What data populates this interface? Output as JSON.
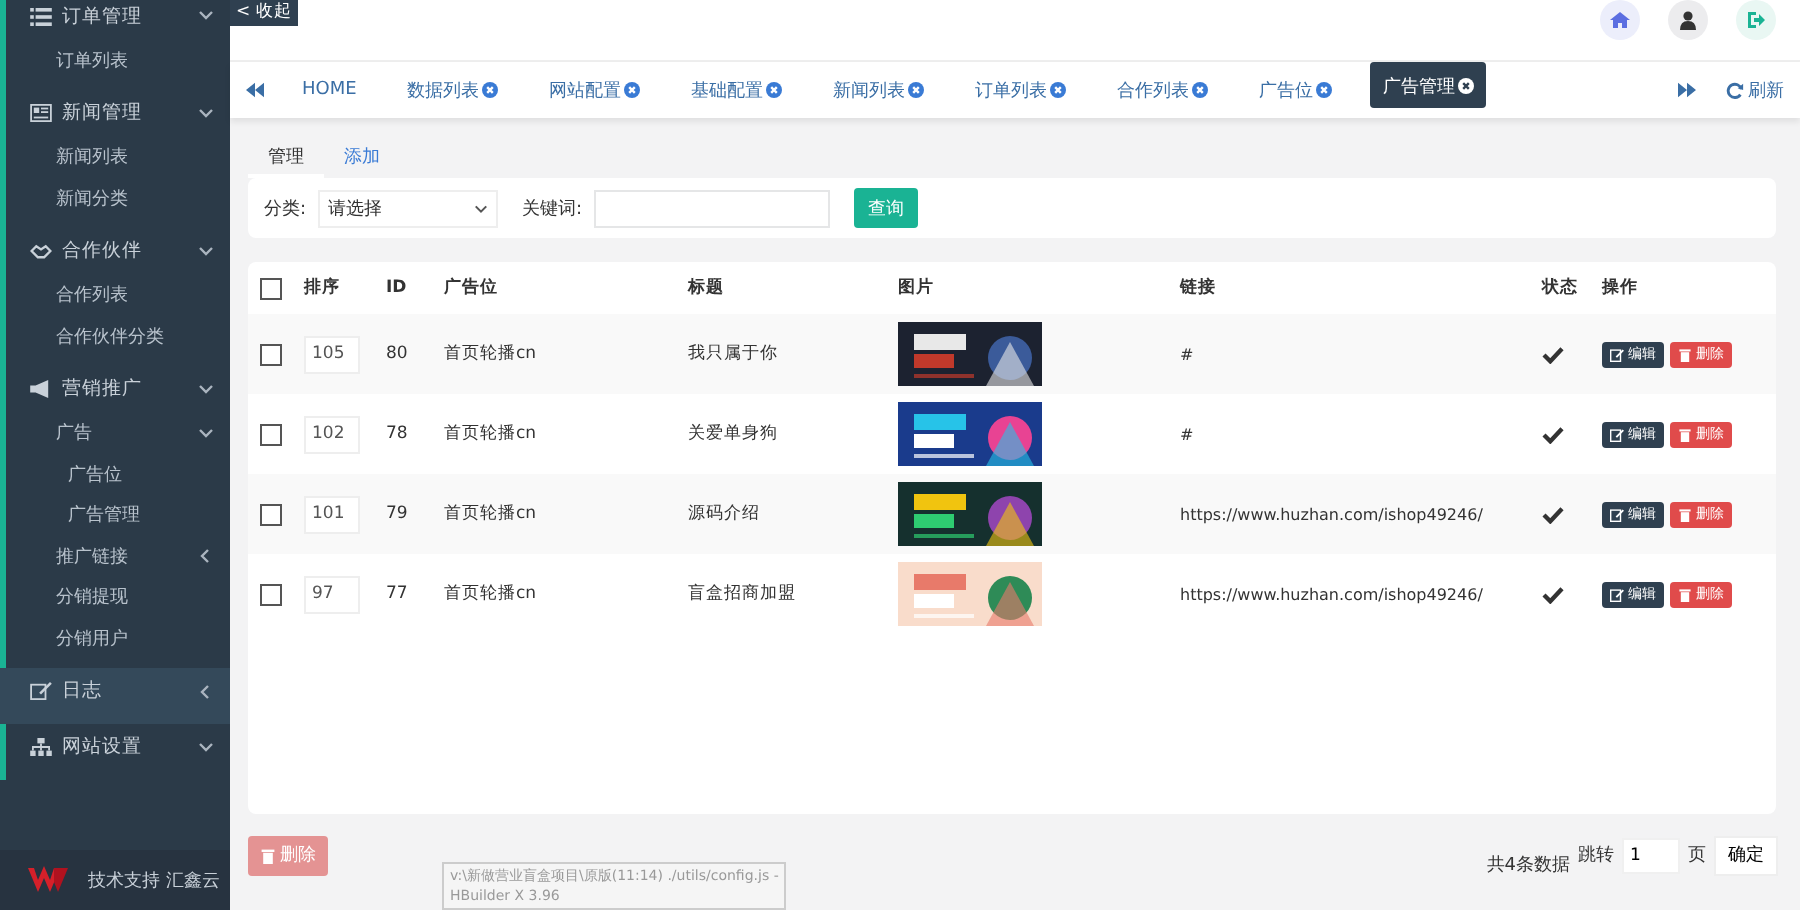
{
  "sidebar": {
    "groups": [
      {
        "label": "订单管理",
        "expanded": true,
        "children": [
          {
            "label": "订单列表"
          }
        ]
      },
      {
        "label": "新闻管理",
        "expanded": true,
        "children": [
          {
            "label": "新闻列表"
          },
          {
            "label": "新闻分类"
          }
        ]
      },
      {
        "label": "合作伙伴",
        "expanded": true,
        "children": [
          {
            "label": "合作列表"
          },
          {
            "label": "合作伙伴分类"
          }
        ]
      },
      {
        "label": "营销推广",
        "expanded": true,
        "children": [
          {
            "label": "广告",
            "expanded": true,
            "children": [
              {
                "label": "广告位"
              },
              {
                "label": "广告管理"
              }
            ]
          },
          {
            "label": "推广链接",
            "expanded": false
          },
          {
            "label": "分销提现"
          },
          {
            "label": "分销用户"
          }
        ]
      },
      {
        "label": "日志",
        "expanded": false
      },
      {
        "label": "网站设置",
        "expanded": true
      }
    ],
    "footer": "技术支持 汇鑫云"
  },
  "collapse_button": "< 收起",
  "tabs": [
    {
      "label": "HOME",
      "closable": false,
      "selected": false
    },
    {
      "label": "数据列表",
      "closable": true,
      "selected": false
    },
    {
      "label": "网站配置",
      "closable": true,
      "selected": false
    },
    {
      "label": "基础配置",
      "closable": true,
      "selected": false
    },
    {
      "label": "新闻列表",
      "closable": true,
      "selected": false
    },
    {
      "label": "订单列表",
      "closable": true,
      "selected": false
    },
    {
      "label": "合作列表",
      "closable": true,
      "selected": false
    },
    {
      "label": "广告位",
      "closable": true,
      "selected": false
    },
    {
      "label": "广告管理",
      "closable": true,
      "selected": true
    }
  ],
  "refresh": "刷新",
  "sub_tabs": [
    {
      "label": "管理",
      "selected": true
    },
    {
      "label": "添加",
      "selected": false
    }
  ],
  "filter": {
    "category_label": "分类:",
    "category_value": "请选择",
    "keyword_label": "关键词:",
    "search_button": "查询"
  },
  "table": {
    "header_checked": false,
    "columns": [
      "排序",
      "ID",
      "广告位",
      "标题",
      "图片",
      "链接",
      "状态",
      "操作"
    ],
    "rows": [
      {
        "checked": false,
        "sort": "105",
        "id": "80",
        "position": "首页轮播cn",
        "title": "我只属于你",
        "link": "#",
        "enabled": true,
        "edit": "编辑",
        "delete": "删除"
      },
      {
        "checked": false,
        "sort": "102",
        "id": "78",
        "position": "首页轮播cn",
        "title": "关爱单身狗",
        "link": "#",
        "enabled": true,
        "edit": "编辑",
        "delete": "删除"
      },
      {
        "checked": false,
        "sort": "101",
        "id": "79",
        "position": "首页轮播cn",
        "title": "源码介绍",
        "link": "https://www.huzhan.com/ishop49246/",
        "enabled": true,
        "edit": "编辑",
        "delete": "删除"
      },
      {
        "checked": false,
        "sort": "97",
        "id": "77",
        "position": "首页轮播cn",
        "title": "盲盒招商加盟",
        "link": "https://www.huzhan.com/ishop49246/",
        "enabled": true,
        "edit": "编辑",
        "delete": "删除"
      }
    ]
  },
  "bulk_delete": "删除",
  "pagination": {
    "total": "共4条数据",
    "jump_label": "跳转",
    "page": "1",
    "page_unit": "页",
    "confirm": "确定"
  },
  "tooltip": [
    "v:\\新做营业盲盒项目\\原版(11:14) ./utils/config.js -",
    "HBuilder X 3.96"
  ]
}
